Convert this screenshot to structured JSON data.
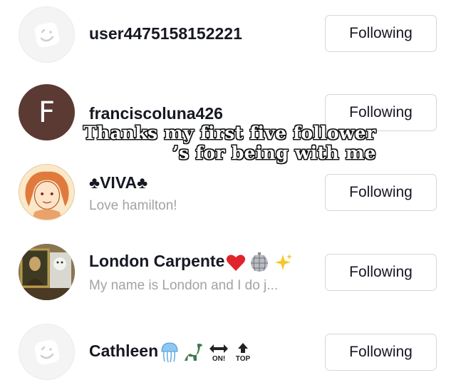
{
  "follow_list": [
    {
      "username": "user4475158152221",
      "bio": "",
      "avatar": "default-avatar",
      "button_label": "Following",
      "name_emojis": []
    },
    {
      "username": "franciscoluna426",
      "bio": "",
      "avatar": "letter-avatar",
      "avatar_letter": "F",
      "button_label": "Following",
      "name_emojis": []
    },
    {
      "username": "♣VIVA♣",
      "bio": "Love hamilton!",
      "avatar": "drawn-portrait-avatar",
      "button_label": "Following",
      "name_emojis": []
    },
    {
      "username": "London Carpente",
      "bio": "My name is London and I do j...",
      "avatar": "photo-avatar",
      "button_label": "Following",
      "name_emojis": [
        "red-heart",
        "disco-ball",
        "sparkles"
      ]
    },
    {
      "username": "Cathleen",
      "bio": "",
      "avatar": "default-avatar",
      "button_label": "Following",
      "name_emojis": [
        "jellyfish",
        "dinosaur",
        "on-arrow",
        "top-arrow"
      ]
    }
  ],
  "overlay_caption": {
    "line1": "Thanks my first five follower",
    "line2": "’s for being with me"
  },
  "emoji_labels": {
    "on": "ON!",
    "top": "TOP"
  },
  "colors": {
    "text": "#161823",
    "secondary": "#a3a3a7",
    "border": "#d6d6d9",
    "letter_avatar": "#5b3a33"
  }
}
